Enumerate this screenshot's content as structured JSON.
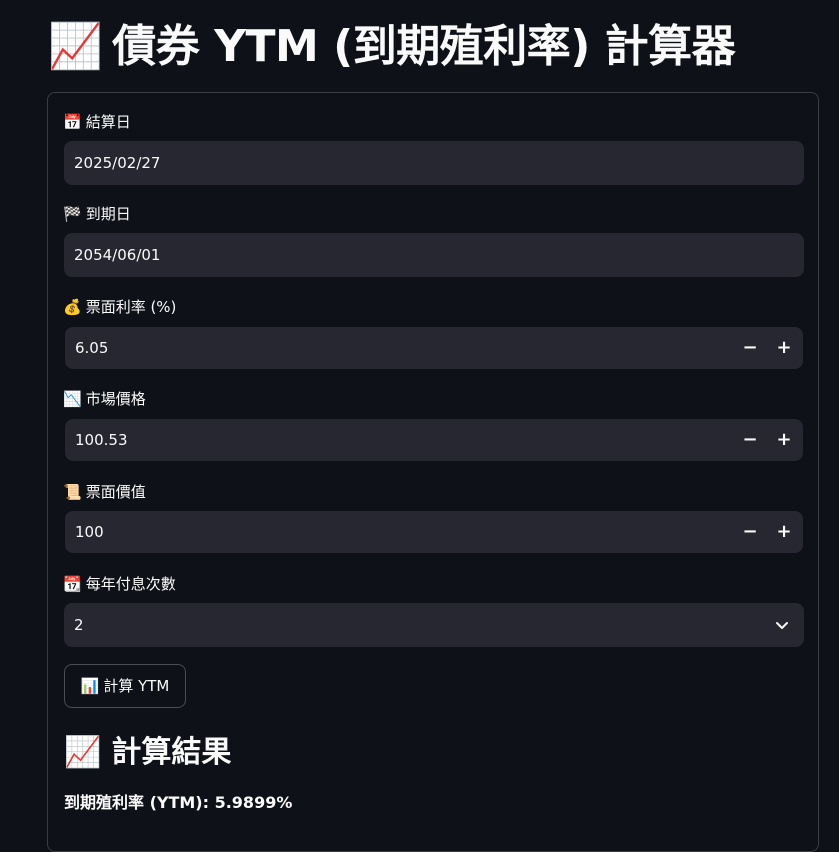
{
  "header": {
    "icon": "📈",
    "title": "債券 YTM (到期殖利率) 計算器"
  },
  "form": {
    "settlement_date": {
      "icon": "📅",
      "label": "結算日",
      "value": "2025/02/27"
    },
    "maturity_date": {
      "icon": "🏁",
      "label": "到期日",
      "value": "2054/06/01"
    },
    "coupon_rate": {
      "icon": "💰",
      "label": "票面利率 (%)",
      "value": "6.05",
      "minus": "−",
      "plus": "+"
    },
    "market_price": {
      "icon": "📉",
      "label": "市場價格",
      "value": "100.53",
      "minus": "−",
      "plus": "+"
    },
    "face_value": {
      "icon": "📜",
      "label": "票面價值",
      "value": "100",
      "minus": "−",
      "plus": "+"
    },
    "frequency": {
      "icon": "📆",
      "label": "每年付息次數",
      "value": "2"
    },
    "calculate_button": {
      "icon": "📊",
      "label": "計算 YTM"
    }
  },
  "results": {
    "icon": "📈",
    "title": "計算結果",
    "ytm_text": "到期殖利率 (YTM): 5.9899%"
  },
  "colors": {
    "background": "#0e1117",
    "input_background": "#262730",
    "border": "#3a3d46",
    "text": "#fafafa"
  }
}
